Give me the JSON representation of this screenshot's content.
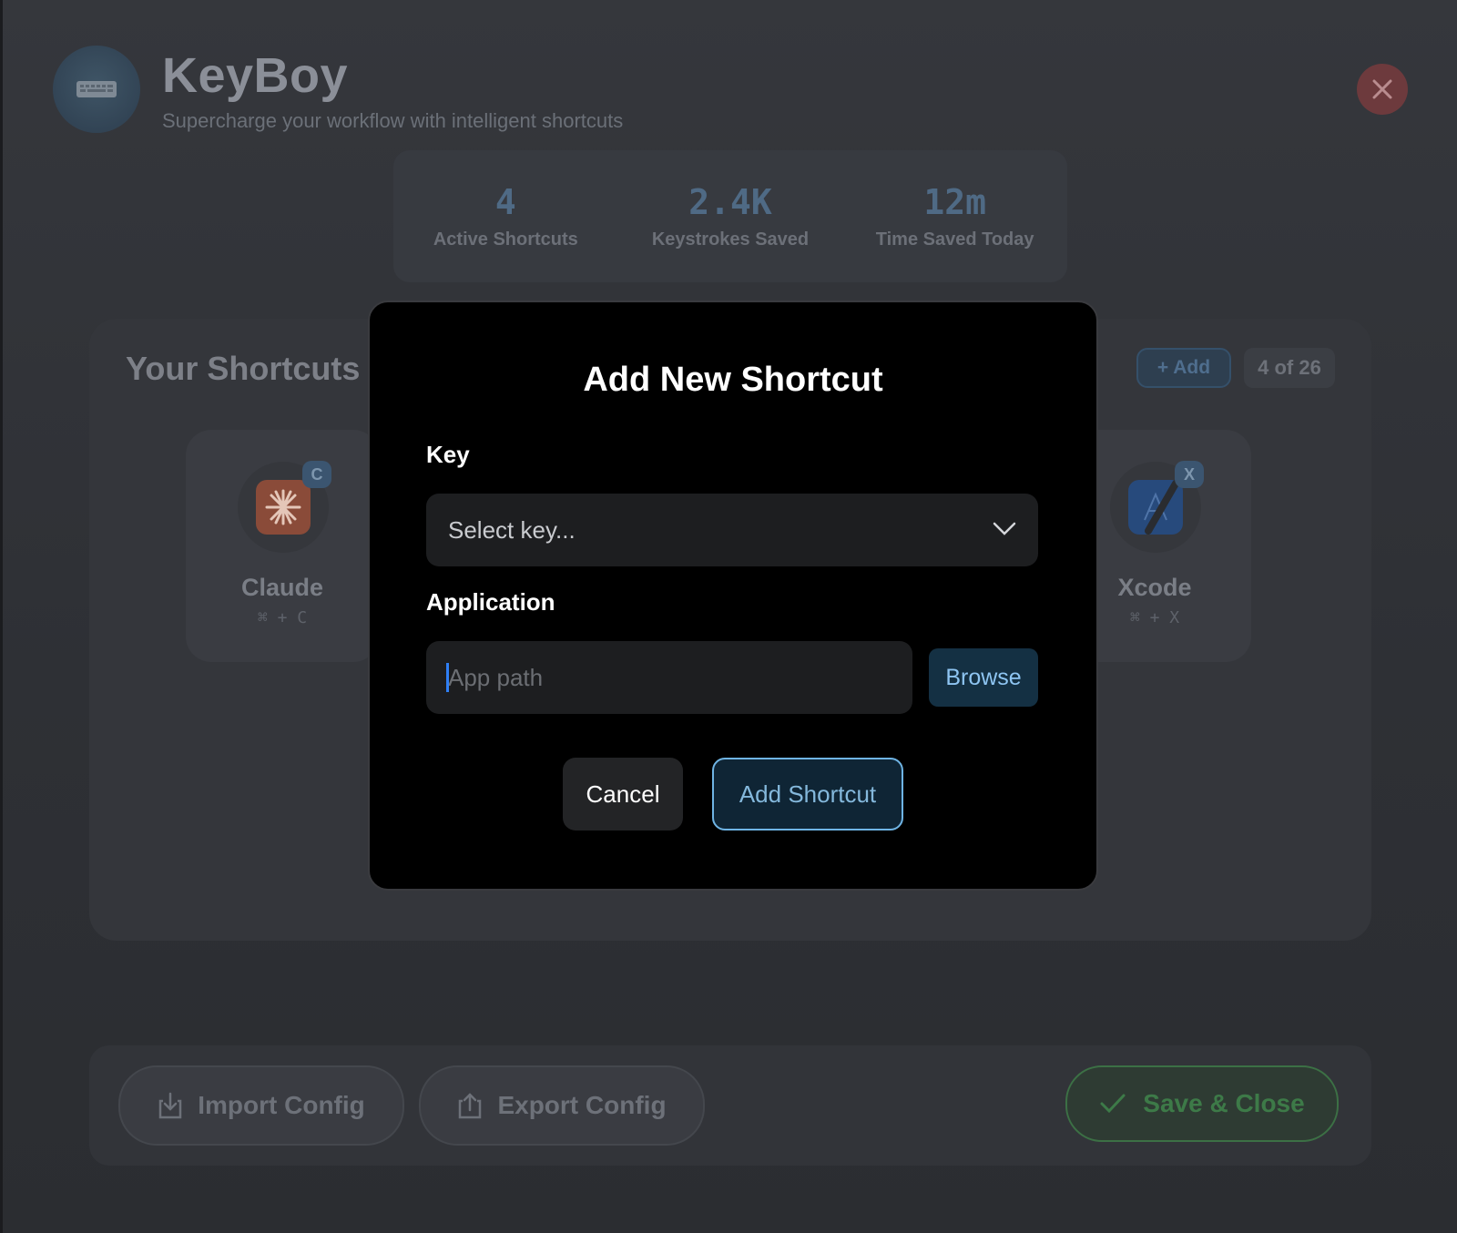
{
  "app": {
    "title": "KeyBoy",
    "subtitle": "Supercharge your workflow with intelligent shortcuts",
    "logo_icon": "keyboard-icon",
    "close_icon": "close-icon"
  },
  "stats": [
    {
      "value": "4",
      "label": "Active Shortcuts"
    },
    {
      "value": "2.4K",
      "label": "Keystrokes Saved"
    },
    {
      "value": "12m",
      "label": "Time Saved Today"
    }
  ],
  "shortcuts_panel": {
    "title": "Your Shortcuts",
    "add_label": "+ Add",
    "count_label": "4 of 26",
    "cards": [
      {
        "key": "C",
        "name": "Claude",
        "combo": "⌘ + C",
        "icon": "claude-app-icon"
      },
      {
        "key": "X",
        "name": "Xcode",
        "combo": "⌘ + X",
        "icon": "xcode-app-icon"
      }
    ]
  },
  "footer": {
    "import_label": "Import Config",
    "export_label": "Export Config",
    "save_label": "Save & Close"
  },
  "modal": {
    "title": "Add New Shortcut",
    "key_label": "Key",
    "key_select_value": "Select key...",
    "application_label": "Application",
    "app_path_placeholder": "App path",
    "app_path_value": "",
    "browse_label": "Browse",
    "cancel_label": "Cancel",
    "submit_label": "Add Shortcut"
  },
  "colors": {
    "modal_bg": "#000000",
    "accent_blue": "#6fb4e4",
    "save_green": "#3c7045",
    "close_red": "#6d3a3d"
  }
}
